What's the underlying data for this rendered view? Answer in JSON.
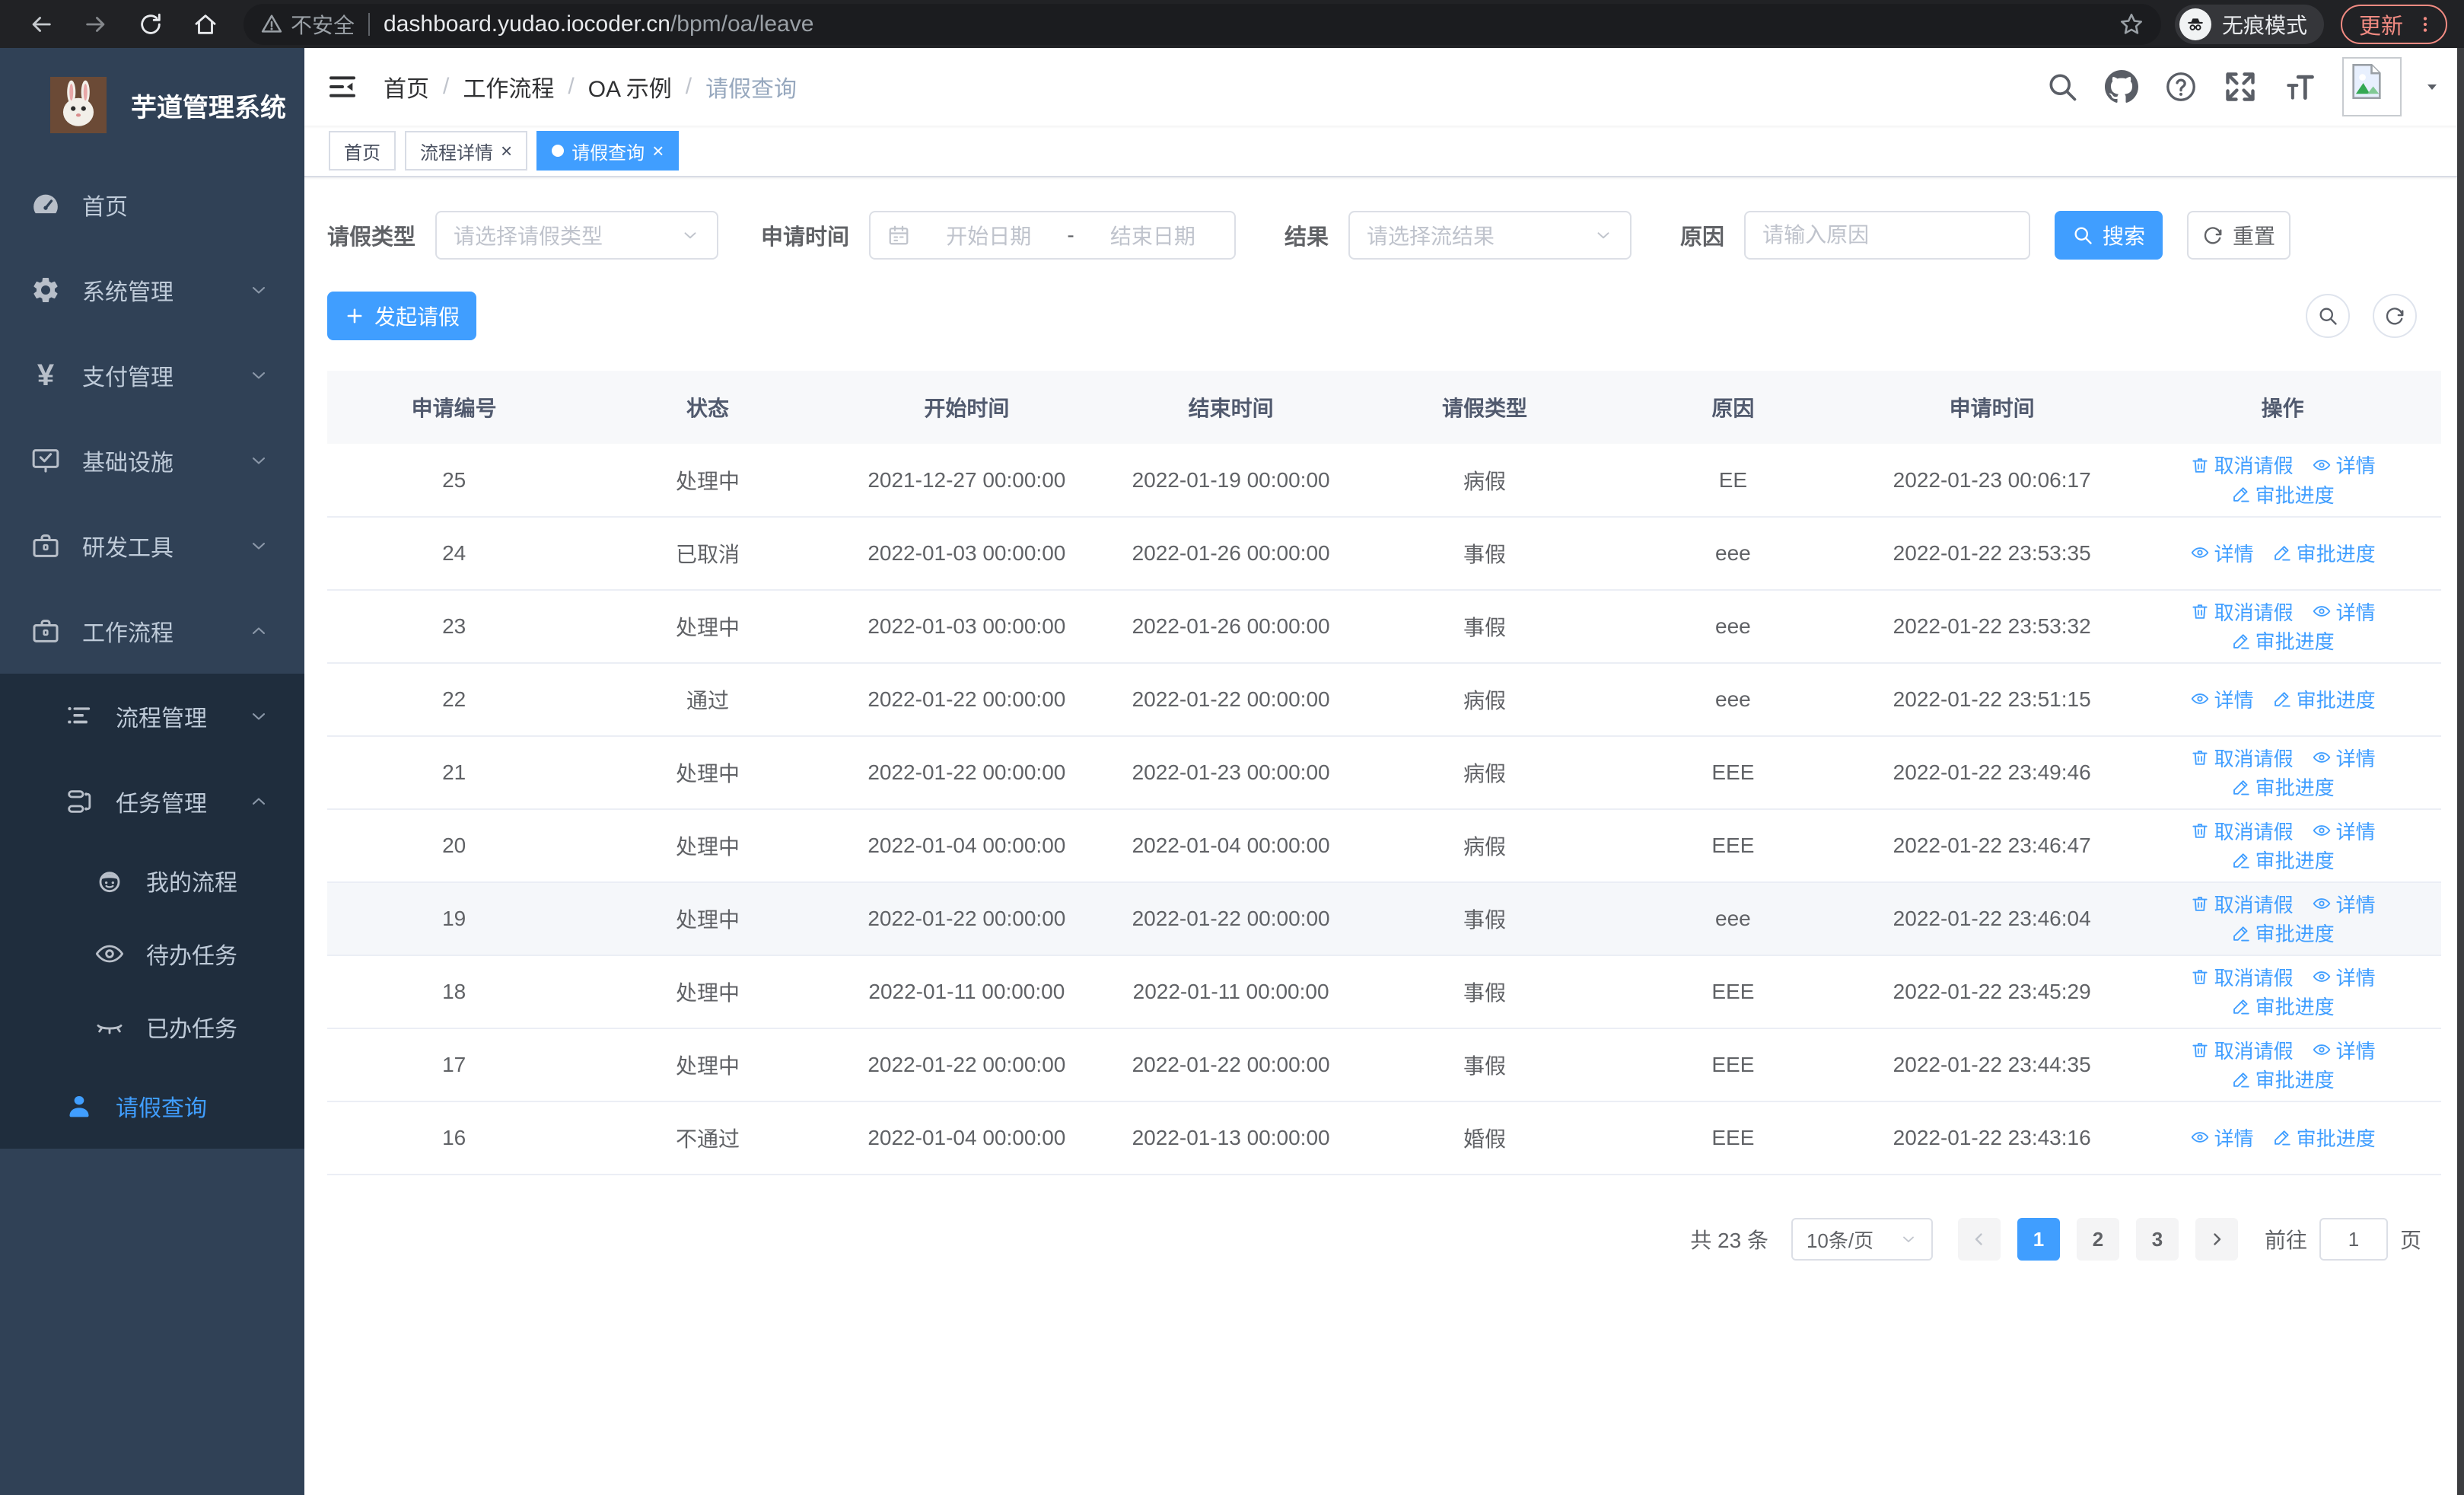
{
  "browser": {
    "security_label": "不安全",
    "url_host": "dashboard.yudao.iocoder.cn",
    "url_path": "/bpm/oa/leave",
    "incognito_label": "无痕模式",
    "update_label": "更新"
  },
  "sidebar": {
    "app_title": "芋道管理系统",
    "items": [
      {
        "label": "首页",
        "icon": "dashboard-icon"
      },
      {
        "label": "系统管理",
        "icon": "gear-icon"
      },
      {
        "label": "支付管理",
        "icon": "yen-icon"
      },
      {
        "label": "基础设施",
        "icon": "monitor-icon"
      },
      {
        "label": "研发工具",
        "icon": "briefcase-icon"
      },
      {
        "label": "工作流程",
        "icon": "briefcase-icon"
      },
      {
        "label": "流程管理",
        "icon": "list-icon"
      },
      {
        "label": "任务管理",
        "icon": "flow-icon"
      },
      {
        "label": "我的流程",
        "icon": "robot-icon"
      },
      {
        "label": "待办任务",
        "icon": "eye-open-icon"
      },
      {
        "label": "已办任务",
        "icon": "eye-closed-icon"
      },
      {
        "label": "请假查询",
        "icon": "user-icon"
      }
    ]
  },
  "breadcrumb": {
    "separator": "/",
    "items": [
      "首页",
      "工作流程",
      "OA 示例",
      "请假查询"
    ]
  },
  "tabs": [
    {
      "label": "首页"
    },
    {
      "label": "流程详情"
    },
    {
      "label": "请假查询"
    }
  ],
  "filters": {
    "leave_type": {
      "label": "请假类型",
      "placeholder": "请选择请假类型"
    },
    "apply_time": {
      "label": "申请时间",
      "start_placeholder": "开始日期",
      "separator": "-",
      "end_placeholder": "结束日期"
    },
    "result": {
      "label": "结果",
      "placeholder": "请选择流结果"
    },
    "reason": {
      "label": "原因",
      "placeholder": "请输入原因"
    },
    "search_label": "搜索",
    "reset_label": "重置"
  },
  "toolbar": {
    "create_label": "发起请假"
  },
  "table": {
    "columns": [
      "申请编号",
      "状态",
      "开始时间",
      "结束时间",
      "请假类型",
      "原因",
      "申请时间",
      "操作"
    ],
    "action_labels": {
      "cancel": "取消请假",
      "detail": "详情",
      "progress": "审批进度"
    },
    "rows": [
      {
        "id": "25",
        "status": "处理中",
        "start": "2021-12-27 00:00:00",
        "end": "2022-01-19 00:00:00",
        "type": "病假",
        "reason": "EE",
        "applied": "2022-01-23 00:06:17",
        "actions": [
          "cancel",
          "detail",
          "progress"
        ]
      },
      {
        "id": "24",
        "status": "已取消",
        "start": "2022-01-03 00:00:00",
        "end": "2022-01-26 00:00:00",
        "type": "事假",
        "reason": "eee",
        "applied": "2022-01-22 23:53:35",
        "actions": [
          "detail",
          "progress"
        ]
      },
      {
        "id": "23",
        "status": "处理中",
        "start": "2022-01-03 00:00:00",
        "end": "2022-01-26 00:00:00",
        "type": "事假",
        "reason": "eee",
        "applied": "2022-01-22 23:53:32",
        "actions": [
          "cancel",
          "detail",
          "progress"
        ]
      },
      {
        "id": "22",
        "status": "通过",
        "start": "2022-01-22 00:00:00",
        "end": "2022-01-22 00:00:00",
        "type": "病假",
        "reason": "eee",
        "applied": "2022-01-22 23:51:15",
        "actions": [
          "detail",
          "progress"
        ]
      },
      {
        "id": "21",
        "status": "处理中",
        "start": "2022-01-22 00:00:00",
        "end": "2022-01-23 00:00:00",
        "type": "病假",
        "reason": "EEE",
        "applied": "2022-01-22 23:49:46",
        "actions": [
          "cancel",
          "detail",
          "progress"
        ]
      },
      {
        "id": "20",
        "status": "处理中",
        "start": "2022-01-04 00:00:00",
        "end": "2022-01-04 00:00:00",
        "type": "病假",
        "reason": "EEE",
        "applied": "2022-01-22 23:46:47",
        "actions": [
          "cancel",
          "detail",
          "progress"
        ]
      },
      {
        "id": "19",
        "status": "处理中",
        "start": "2022-01-22 00:00:00",
        "end": "2022-01-22 00:00:00",
        "type": "事假",
        "reason": "eee",
        "applied": "2022-01-22 23:46:04",
        "actions": [
          "cancel",
          "detail",
          "progress"
        ],
        "highlighted": true
      },
      {
        "id": "18",
        "status": "处理中",
        "start": "2022-01-11 00:00:00",
        "end": "2022-01-11 00:00:00",
        "type": "事假",
        "reason": "EEE",
        "applied": "2022-01-22 23:45:29",
        "actions": [
          "cancel",
          "detail",
          "progress"
        ]
      },
      {
        "id": "17",
        "status": "处理中",
        "start": "2022-01-22 00:00:00",
        "end": "2022-01-22 00:00:00",
        "type": "事假",
        "reason": "EEE",
        "applied": "2022-01-22 23:44:35",
        "actions": [
          "cancel",
          "detail",
          "progress"
        ]
      },
      {
        "id": "16",
        "status": "不通过",
        "start": "2022-01-04 00:00:00",
        "end": "2022-01-13 00:00:00",
        "type": "婚假",
        "reason": "EEE",
        "applied": "2022-01-22 23:43:16",
        "actions": [
          "detail",
          "progress"
        ]
      }
    ]
  },
  "pagination": {
    "total_label": "共 23 条",
    "page_size_label": "10条/页",
    "pages": [
      "1",
      "2",
      "3"
    ],
    "active_page": "1",
    "goto_label": "前往",
    "goto_value": "1",
    "page_unit_label": "页"
  },
  "colors": {
    "accent": "#409eff",
    "sidebar_bg": "#304156",
    "submenu_bg": "#1f2d3d",
    "update_accent": "#f28b82"
  }
}
